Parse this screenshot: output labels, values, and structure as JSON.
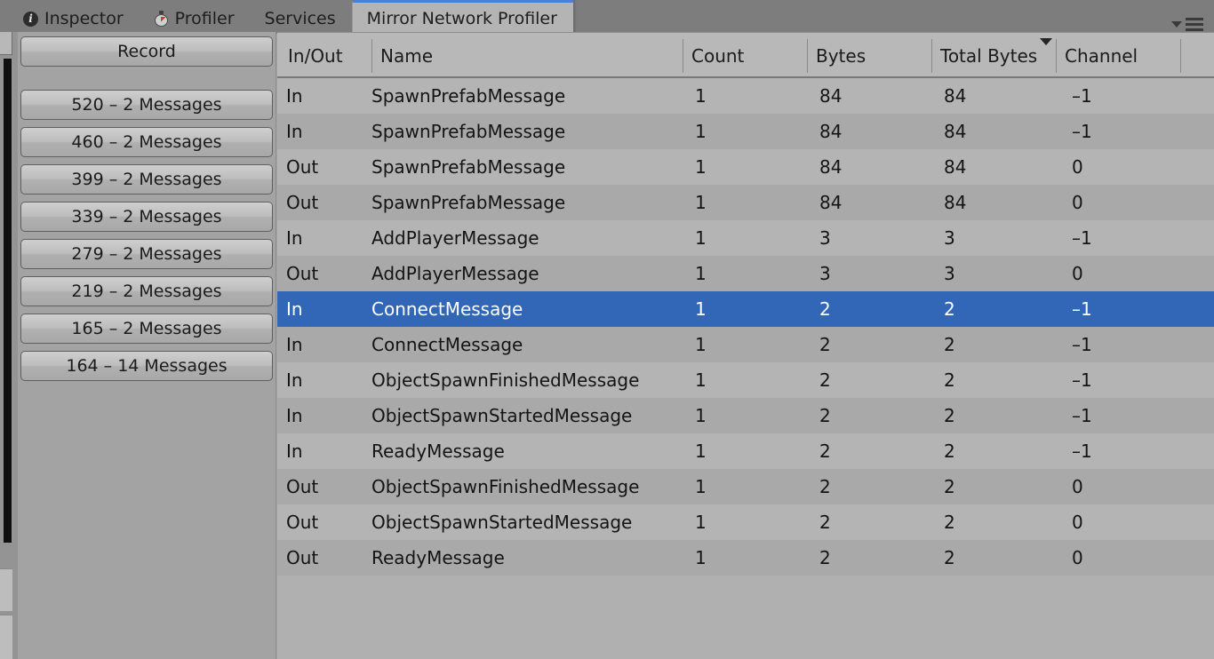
{
  "window": {
    "accent_blue": "#4a81d4",
    "selection_blue": "#3267b8"
  },
  "tabbar": {
    "tabs": [
      {
        "label": "Inspector",
        "icon": "info-icon",
        "active": false
      },
      {
        "label": "Profiler",
        "icon": "stopwatch-icon",
        "active": false
      },
      {
        "label": "Services",
        "icon": "",
        "active": false
      },
      {
        "label": "Mirror Network Profiler",
        "icon": "",
        "active": true
      }
    ],
    "menu": {
      "caret_icon": "chevron-down-icon",
      "hamburger_icon": "hamburger-menu-icon"
    }
  },
  "sidebar": {
    "record_label": "Record",
    "frames": [
      {
        "label": "520 – 2 Messages"
      },
      {
        "label": "460 – 2 Messages"
      },
      {
        "label": "399 – 2 Messages"
      },
      {
        "label": "339 – 2 Messages"
      },
      {
        "label": "279 – 2 Messages"
      },
      {
        "label": "219 – 2 Messages"
      },
      {
        "label": "165 – 2 Messages"
      },
      {
        "label": "164 – 14 Messages"
      }
    ]
  },
  "table": {
    "columns": [
      {
        "key": "inout",
        "label": "In/Out",
        "sorted": false
      },
      {
        "key": "name",
        "label": "Name",
        "sorted": false
      },
      {
        "key": "count",
        "label": "Count",
        "sorted": false
      },
      {
        "key": "bytes",
        "label": "Bytes",
        "sorted": false
      },
      {
        "key": "totalbytes",
        "label": "Total Bytes",
        "sorted": true,
        "sort_dir": "desc"
      },
      {
        "key": "channel",
        "label": "Channel",
        "sorted": false
      }
    ],
    "rows": [
      {
        "inout": "In",
        "name": "SpawnPrefabMessage",
        "count": "1",
        "bytes": "84",
        "totalbytes": "84",
        "channel": "–1",
        "selected": false
      },
      {
        "inout": "In",
        "name": "SpawnPrefabMessage",
        "count": "1",
        "bytes": "84",
        "totalbytes": "84",
        "channel": "–1",
        "selected": false
      },
      {
        "inout": "Out",
        "name": "SpawnPrefabMessage",
        "count": "1",
        "bytes": "84",
        "totalbytes": "84",
        "channel": "0",
        "selected": false
      },
      {
        "inout": "Out",
        "name": "SpawnPrefabMessage",
        "count": "1",
        "bytes": "84",
        "totalbytes": "84",
        "channel": "0",
        "selected": false
      },
      {
        "inout": "In",
        "name": "AddPlayerMessage",
        "count": "1",
        "bytes": "3",
        "totalbytes": "3",
        "channel": "–1",
        "selected": false
      },
      {
        "inout": "Out",
        "name": "AddPlayerMessage",
        "count": "1",
        "bytes": "3",
        "totalbytes": "3",
        "channel": "0",
        "selected": false
      },
      {
        "inout": "In",
        "name": "ConnectMessage",
        "count": "1",
        "bytes": "2",
        "totalbytes": "2",
        "channel": "–1",
        "selected": true
      },
      {
        "inout": "In",
        "name": "ConnectMessage",
        "count": "1",
        "bytes": "2",
        "totalbytes": "2",
        "channel": "–1",
        "selected": false
      },
      {
        "inout": "In",
        "name": "ObjectSpawnFinishedMessage",
        "count": "1",
        "bytes": "2",
        "totalbytes": "2",
        "channel": "–1",
        "selected": false
      },
      {
        "inout": "In",
        "name": "ObjectSpawnStartedMessage",
        "count": "1",
        "bytes": "2",
        "totalbytes": "2",
        "channel": "–1",
        "selected": false
      },
      {
        "inout": "In",
        "name": "ReadyMessage",
        "count": "1",
        "bytes": "2",
        "totalbytes": "2",
        "channel": "–1",
        "selected": false
      },
      {
        "inout": "Out",
        "name": "ObjectSpawnFinishedMessage",
        "count": "1",
        "bytes": "2",
        "totalbytes": "2",
        "channel": "0",
        "selected": false
      },
      {
        "inout": "Out",
        "name": "ObjectSpawnStartedMessage",
        "count": "1",
        "bytes": "2",
        "totalbytes": "2",
        "channel": "0",
        "selected": false
      },
      {
        "inout": "Out",
        "name": "ReadyMessage",
        "count": "1",
        "bytes": "2",
        "totalbytes": "2",
        "channel": "0",
        "selected": false
      }
    ]
  }
}
